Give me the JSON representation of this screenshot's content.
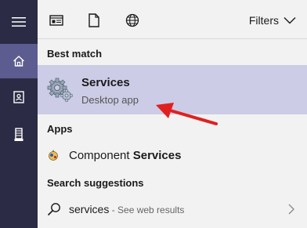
{
  "rail": {
    "items": [
      {
        "icon": "hamburger-menu-icon"
      },
      {
        "icon": "home-icon",
        "active": true
      },
      {
        "icon": "notebook-icon"
      },
      {
        "icon": "device-icon"
      }
    ],
    "active_color": "#5c5c90",
    "bg_color": "#2b2b45"
  },
  "toolbar": {
    "icons": [
      "apps-icon",
      "documents-icon",
      "web-icon"
    ],
    "filters_label": "Filters"
  },
  "sections": {
    "best_match": "Best match",
    "apps": "Apps",
    "search_suggestions": "Search suggestions"
  },
  "best_match": {
    "title": "Services",
    "subtitle": "Desktop app",
    "highlight_color": "#cccce6"
  },
  "apps": [
    {
      "prefix": "Component ",
      "bold": "Services"
    }
  ],
  "suggestions": [
    {
      "query": "services",
      "hint": " - See web results"
    }
  ],
  "annotation": {
    "arrow_color": "#e02020"
  }
}
